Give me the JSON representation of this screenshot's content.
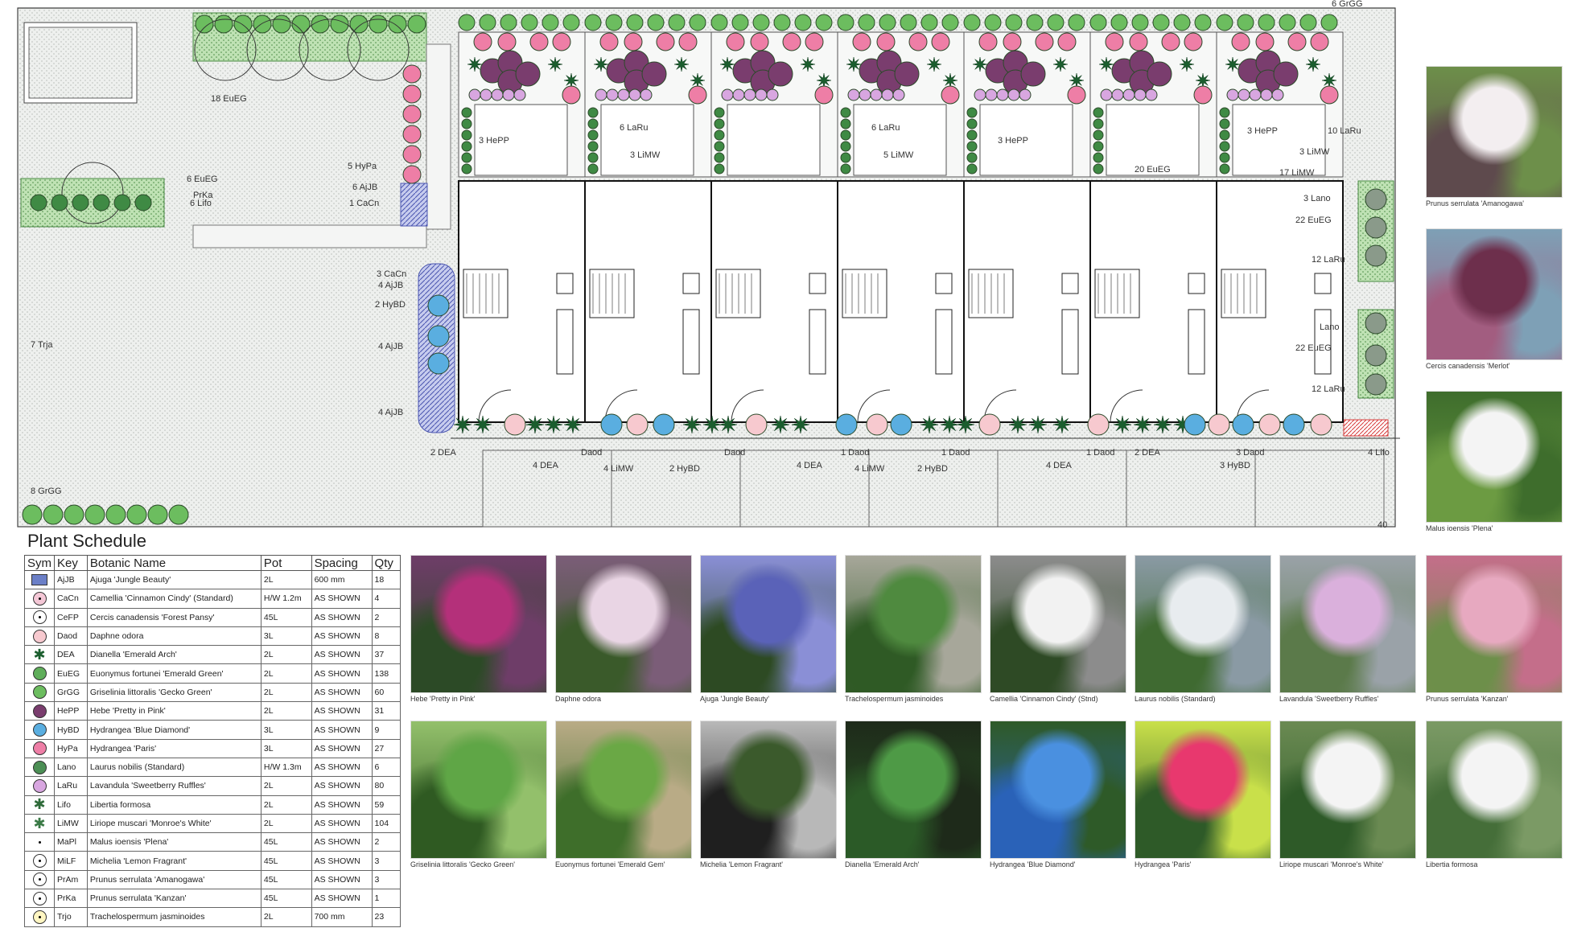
{
  "plan": {
    "scale_note": "40",
    "labels": [
      {
        "text": "18 EuEG"
      },
      {
        "text": "6 EuEG"
      },
      {
        "text": "PrKa"
      },
      {
        "text": "6 Lifo"
      },
      {
        "text": "5 HyPa"
      },
      {
        "text": "6 AjJB"
      },
      {
        "text": "1 CaCn"
      },
      {
        "text": "3 CaCn"
      },
      {
        "text": "4 AjJB"
      },
      {
        "text": "2 HyBD"
      },
      {
        "text": "4 AjJB"
      },
      {
        "text": "4 AjJB"
      },
      {
        "text": "7 Trja"
      },
      {
        "text": "8 GrGG"
      },
      {
        "text": "3 Lano"
      },
      {
        "text": "22 EuEG"
      },
      {
        "text": "12 LaRu"
      },
      {
        "text": "Lano"
      },
      {
        "text": "22 EuEG"
      },
      {
        "text": "12 LaRu"
      },
      {
        "text": "2 DEA"
      },
      {
        "text": "4 DEA"
      },
      {
        "text": "Daod"
      },
      {
        "text": "4 LiMW"
      },
      {
        "text": "2 HyBD"
      },
      {
        "text": "Daod"
      },
      {
        "text": "4 DEA"
      },
      {
        "text": "1 Daod"
      },
      {
        "text": "4 LiMW"
      },
      {
        "text": "2 HyBD"
      },
      {
        "text": "1 Daod"
      },
      {
        "text": "4 DEA"
      },
      {
        "text": "1 Daod"
      },
      {
        "text": "2 DEA"
      },
      {
        "text": "3 HyBD"
      },
      {
        "text": "3 Daod"
      },
      {
        "text": "4 Lifo"
      },
      {
        "text": "3 HePP"
      },
      {
        "text": "6 LaRu"
      },
      {
        "text": "3 LiMW"
      },
      {
        "text": "6 LaRu"
      },
      {
        "text": "3 HePP"
      },
      {
        "text": "5 LiMW"
      },
      {
        "text": "3 HePP"
      },
      {
        "text": "10 LaRu"
      },
      {
        "text": "3 LiMW"
      },
      {
        "text": "20 EuEG"
      },
      {
        "text": "17 LiMW"
      },
      {
        "text": "6 GrGG"
      }
    ]
  },
  "schedule": {
    "title": "Plant Schedule",
    "headers": {
      "sym": "Sym",
      "key": "Key",
      "name": "Botanic Name",
      "pot": "Pot",
      "spacing": "Spacing",
      "qty": "Qty"
    },
    "rows": [
      {
        "key": "AjJB",
        "name": "Ajuga 'Jungle Beauty'",
        "pot": "2L",
        "spacing": "600 mm",
        "qty": "18",
        "style": "sq",
        "color": "#6b7fc7"
      },
      {
        "key": "CaCn",
        "name": "Camellia 'Cinnamon Cindy' (Standard)",
        "pot": "H/W 1.2m",
        "spacing": "AS SHOWN",
        "qty": "4",
        "style": "dot",
        "color": "#f4c7d6"
      },
      {
        "key": "CeFP",
        "name": "Cercis canadensis 'Forest Pansy'",
        "pot": "45L",
        "spacing": "AS SHOWN",
        "qty": "2",
        "style": "dot",
        "color": "#ffffff"
      },
      {
        "key": "Daod",
        "name": "Daphne odora",
        "pot": "3L",
        "spacing": "AS SHOWN",
        "qty": "8",
        "style": "plain",
        "color": "#f7c9cf"
      },
      {
        "key": "DEA",
        "name": "Dianella 'Emerald Arch'",
        "pot": "2L",
        "spacing": "AS SHOWN",
        "qty": "37",
        "style": "star",
        "color": "#1b5e2e"
      },
      {
        "key": "EuEG",
        "name": "Euonymus fortunei 'Emerald Green'",
        "pot": "2L",
        "spacing": "AS SHOWN",
        "qty": "138",
        "style": "plain",
        "color": "#5fae5a"
      },
      {
        "key": "GrGG",
        "name": "Griselinia littoralis 'Gecko Green'",
        "pot": "2L",
        "spacing": "AS SHOWN",
        "qty": "60",
        "style": "plain",
        "color": "#6cbd5f"
      },
      {
        "key": "HePP",
        "name": "Hebe 'Pretty in Pink'",
        "pot": "2L",
        "spacing": "AS SHOWN",
        "qty": "31",
        "style": "plain",
        "color": "#7a3d6e"
      },
      {
        "key": "HyBD",
        "name": "Hydrangea 'Blue Diamond'",
        "pot": "3L",
        "spacing": "AS SHOWN",
        "qty": "9",
        "style": "plain",
        "color": "#5aaee0"
      },
      {
        "key": "HyPa",
        "name": "Hydrangea 'Paris'",
        "pot": "3L",
        "spacing": "AS SHOWN",
        "qty": "27",
        "style": "plain",
        "color": "#ee7ea6"
      },
      {
        "key": "Lano",
        "name": "Laurus nobilis (Standard)",
        "pot": "H/W 1.3m",
        "spacing": "AS SHOWN",
        "qty": "6",
        "style": "plain",
        "color": "#4c8f55"
      },
      {
        "key": "LaRu",
        "name": "Lavandula 'Sweetberry Ruffles'",
        "pot": "2L",
        "spacing": "AS SHOWN",
        "qty": "80",
        "style": "plain",
        "color": "#d8a6e0"
      },
      {
        "key": "Lifo",
        "name": "Libertia formosa",
        "pot": "2L",
        "spacing": "AS SHOWN",
        "qty": "59",
        "style": "star",
        "color": "#2f6b3a"
      },
      {
        "key": "LiMW",
        "name": "Liriope muscari 'Monroe's White'",
        "pot": "2L",
        "spacing": "AS SHOWN",
        "qty": "104",
        "style": "star",
        "color": "#3a7a46"
      },
      {
        "key": "MaPl",
        "name": "Malus ioensis 'Plena'",
        "pot": "45L",
        "spacing": "AS SHOWN",
        "qty": "2",
        "style": "tiny",
        "color": "#000000"
      },
      {
        "key": "MiLF",
        "name": "Michelia 'Lemon Fragrant'",
        "pot": "45L",
        "spacing": "AS SHOWN",
        "qty": "3",
        "style": "dot",
        "color": "#ffffff"
      },
      {
        "key": "PrAm",
        "name": "Prunus serrulata 'Amanogawa'",
        "pot": "45L",
        "spacing": "AS SHOWN",
        "qty": "3",
        "style": "dot",
        "color": "#ffffff"
      },
      {
        "key": "PrKa",
        "name": "Prunus serrulata 'Kanzan'",
        "pot": "45L",
        "spacing": "AS SHOWN",
        "qty": "1",
        "style": "dot",
        "color": "#ffffff"
      },
      {
        "key": "Trjo",
        "name": "Trachelospermum jasminoides",
        "pot": "2L",
        "spacing": "700 mm",
        "qty": "23",
        "style": "dot",
        "color": "#fff6c2"
      }
    ]
  },
  "photos": [
    {
      "caption": "Prunus serrulata 'Amanogawa'",
      "c1": "#f3eef0",
      "c2": "#5e4a4d",
      "c3": "#6d8f4a"
    },
    {
      "caption": "Cercis canadensis 'Merlot'",
      "c1": "#6d2f4c",
      "c2": "#a25d80",
      "c3": "#7ea0b6"
    },
    {
      "caption": "Malus ioensis 'Plena'",
      "c1": "#f4f4f4",
      "c2": "#6c9b42",
      "c3": "#3e6d2c"
    },
    {
      "caption": "Hebe 'Pretty in Pink'",
      "c1": "#b4307a",
      "c2": "#2c4a26",
      "c3": "#6e3d68"
    },
    {
      "caption": "Daphne odora",
      "c1": "#e9d5e4",
      "c2": "#3a5a2a",
      "c3": "#7b5d78"
    },
    {
      "caption": "Ajuga 'Jungle Beauty'",
      "c1": "#5a62b8",
      "c2": "#2d4a23",
      "c3": "#8a8fd6"
    },
    {
      "caption": "Trachelospermum jasminoides",
      "c1": "#4f8a3f",
      "c2": "#2f5a25",
      "c3": "#a7a79a"
    },
    {
      "caption": "Camellia 'Cinnamon Cindy' (Stnd)",
      "c1": "#f2f2f2",
      "c2": "#2e4a25",
      "c3": "#8c8c8c"
    },
    {
      "caption": "Laurus nobilis (Standard)",
      "c1": "#e8ecef",
      "c2": "#3f6a31",
      "c3": "#8a9aa4"
    },
    {
      "caption": "Lavandula 'Sweetberry Ruffles'",
      "c1": "#dab0dc",
      "c2": "#5b7a4a",
      "c3": "#9aa2a8"
    },
    {
      "caption": "Prunus serrulata 'Kanzan'",
      "c1": "#e7a9c0",
      "c2": "#6d8f4a",
      "c3": "#c46e8a"
    },
    {
      "caption": "Griselinia littoralis 'Gecko Green'",
      "c1": "#5fa646",
      "c2": "#2f5a22",
      "c3": "#93c06b"
    },
    {
      "caption": "Euonymus fortunei 'Emerald Gem'",
      "c1": "#6aa845",
      "c2": "#3e6e2a",
      "c3": "#b9ab86"
    },
    {
      "caption": "Michelia 'Lemon Fragrant'",
      "c1": "#3b5a2c",
      "c2": "#1f1f1f",
      "c3": "#b8b8b8"
    },
    {
      "caption": "Dianella 'Emerald Arch'",
      "c1": "#4e9a46",
      "c2": "#2b5a27",
      "c3": "#1e2a1a"
    },
    {
      "caption": "Hydrangea 'Blue Diamond'",
      "c1": "#4a90e0",
      "c2": "#2a62b8",
      "c3": "#2e5a28"
    },
    {
      "caption": "Hydrangea 'Paris'",
      "c1": "#e8386e",
      "c2": "#2e5a28",
      "c3": "#c9e04a"
    },
    {
      "caption": "Liriope muscari 'Monroe's White'",
      "c1": "#f4f4f4",
      "c2": "#2e5a28",
      "c3": "#6a8a52"
    },
    {
      "caption": "Libertia formosa",
      "c1": "#f4f4f4",
      "c2": "#456e39",
      "c3": "#7b9a65"
    }
  ]
}
